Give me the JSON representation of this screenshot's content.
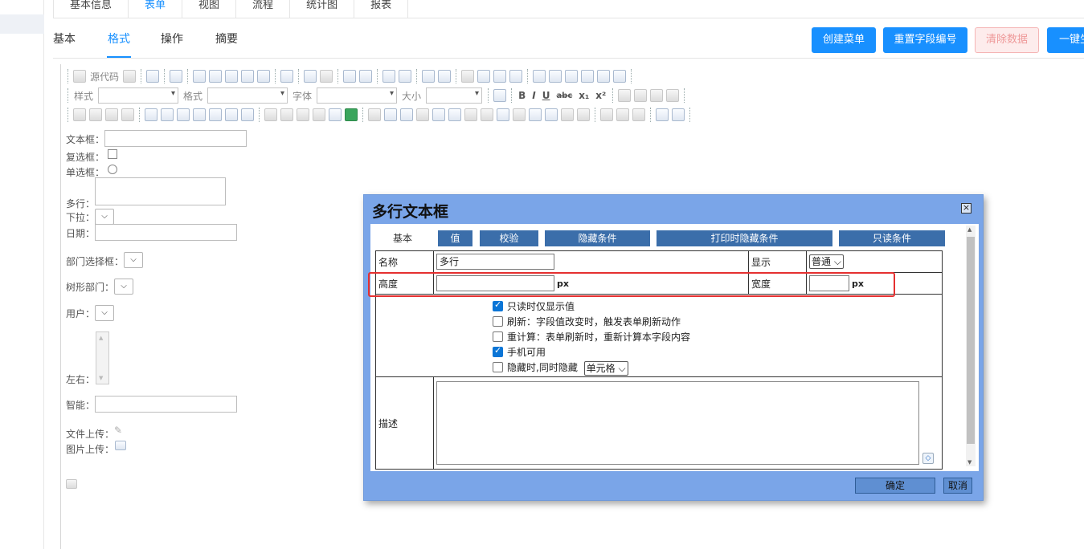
{
  "top_tabs": [
    "基本信息",
    "表单",
    "视图",
    "流程",
    "统计图",
    "报表"
  ],
  "top_tab_active": "表单",
  "sub_tabs": [
    "基本",
    "格式",
    "操作",
    "摘要"
  ],
  "sub_tab_active": "格式",
  "actions": {
    "create_menu": "创建菜单",
    "reset_field_no": "重置字段编号",
    "clear_data": "清除数据",
    "one_key": "一键生"
  },
  "toolbar": {
    "source_code": "源代码",
    "style_label": "样式",
    "format_label": "格式",
    "font_label": "字体",
    "size_label": "大小"
  },
  "form_fields": {
    "textbox": "文本框：",
    "checkbox": "复选框：",
    "radio": "单选框：",
    "multiline": "多行：",
    "dropdown": "下拉：",
    "date": "日期：",
    "dept_select": "部门选择框：",
    "tree_dept": "树形部门：",
    "user": "用户：",
    "left_right": "左右：",
    "smart": "智能：",
    "file_upload": "文件上传：",
    "image_upload": "图片上传："
  },
  "dialog": {
    "title": "多行文本框",
    "tabs": [
      "基本",
      "值",
      "校验",
      "隐藏条件",
      "打印时隐藏条件",
      "只读条件"
    ],
    "active_tab": "基本",
    "name_label": "名称",
    "name_value": "多行",
    "display_label": "显示",
    "display_value": "普通",
    "height_label": "高度",
    "height_value": "",
    "height_unit": "px",
    "width_label": "宽度",
    "width_value": "",
    "width_unit": "px",
    "options": [
      {
        "label": "只读时仅显示值",
        "checked": true
      },
      {
        "label": "刷新：字段值改变时，触发表单刷新动作",
        "checked": false
      },
      {
        "label": "重计算：表单刷新时，重新计算本字段内容",
        "checked": false
      },
      {
        "label": "手机可用",
        "checked": true
      },
      {
        "label": "隐藏时,同时隐藏",
        "checked": false
      }
    ],
    "hide_scope_value": "单元格",
    "desc_label": "描述",
    "ok": "确定",
    "cancel": "取消"
  },
  "colors": {
    "accent": "#1890ff",
    "dialog_frame": "#7aa5e8",
    "dialog_tab": "#3b6eaa",
    "highlight": "#e53030"
  }
}
